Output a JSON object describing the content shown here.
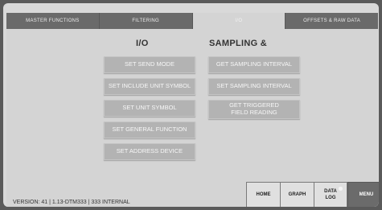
{
  "tabs": [
    {
      "label": "MASTER FUNCTIONS"
    },
    {
      "label": "FILTERING"
    },
    {
      "label": "I/O"
    },
    {
      "label": "OFFSETS & RAW DATA"
    }
  ],
  "active_tab": "I/O",
  "io": {
    "heading": "I/O",
    "buttons": [
      {
        "label": "SET SEND MODE"
      },
      {
        "label": "SET INCLUDE UNIT SYMBOL"
      },
      {
        "label": "SET UNIT SYMBOL"
      },
      {
        "label": "SET GENERAL FUNCTION"
      },
      {
        "label": "SET ADDRESS DEVICE"
      }
    ]
  },
  "sampling": {
    "heading": "SAMPLING &",
    "buttons": [
      {
        "label": "GET SAMPLING INTERVAL"
      },
      {
        "label": "SET SAMPLING INTERVAL"
      },
      {
        "label": "GET TRIGGERED FIELD READING"
      }
    ]
  },
  "version": "VERSION: 41 | 1.13-DTM333 | 333 INTERNAL",
  "nav": {
    "home": "HOME",
    "graph": "GRAPH",
    "data_log": "DATA LOG",
    "menu": "MENU"
  },
  "colors": {
    "tab_bar": "#6a6a6a",
    "panel": "#d4d4d4",
    "button": "#b3b3b3",
    "menu_button": "#6b6b6b"
  }
}
